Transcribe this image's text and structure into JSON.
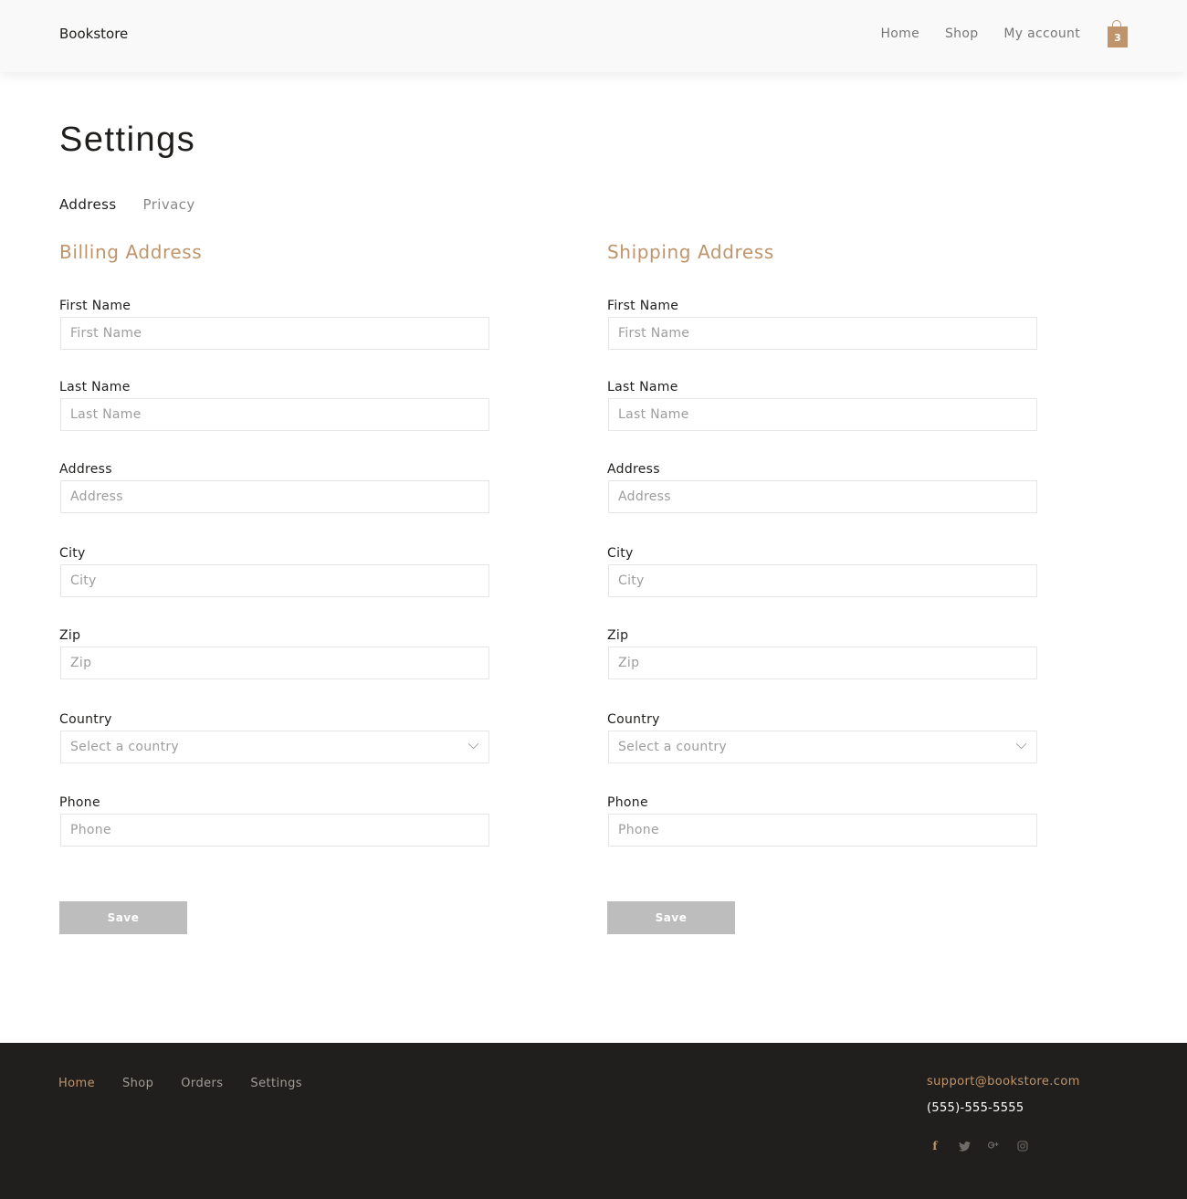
{
  "header": {
    "brand": "Bookstore",
    "nav": [
      "Home",
      "Shop",
      "My account"
    ],
    "cart_count": "3"
  },
  "page": {
    "title": "Settings",
    "tabs": [
      {
        "label": "Address",
        "active": true
      },
      {
        "label": "Privacy",
        "active": false
      }
    ]
  },
  "billing": {
    "heading": "Billing Address",
    "fields": {
      "first_name": {
        "label": "First Name",
        "placeholder": "First Name",
        "value": ""
      },
      "last_name": {
        "label": "Last Name",
        "placeholder": "Last Name",
        "value": ""
      },
      "address": {
        "label": "Address",
        "placeholder": "Address",
        "value": ""
      },
      "city": {
        "label": "City",
        "placeholder": "City",
        "value": ""
      },
      "zip": {
        "label": "Zip",
        "placeholder": "Zip",
        "value": ""
      },
      "country": {
        "label": "Country",
        "selected": "Select a country"
      },
      "phone": {
        "label": "Phone",
        "placeholder": "Phone",
        "value": ""
      }
    },
    "save_label": "Save"
  },
  "shipping": {
    "heading": "Shipping Address",
    "fields": {
      "first_name": {
        "label": "First Name",
        "placeholder": "First Name",
        "value": ""
      },
      "last_name": {
        "label": "Last Name",
        "placeholder": "Last Name",
        "value": ""
      },
      "address": {
        "label": "Address",
        "placeholder": "Address",
        "value": ""
      },
      "city": {
        "label": "City",
        "placeholder": "City",
        "value": ""
      },
      "zip": {
        "label": "Zip",
        "placeholder": "Zip",
        "value": ""
      },
      "country": {
        "label": "Country",
        "selected": "Select a country"
      },
      "phone": {
        "label": "Phone",
        "placeholder": "Phone",
        "value": ""
      }
    },
    "save_label": "Save"
  },
  "footer": {
    "nav": [
      "Home",
      "Shop",
      "Orders",
      "Settings"
    ],
    "active_nav": "Home",
    "email": "support@bookstore.com",
    "phone": "(555)-555-5555",
    "social_icons": [
      "facebook-icon",
      "twitter-icon",
      "google-plus-icon",
      "instagram-icon"
    ]
  },
  "colors": {
    "accent": "#c0946a",
    "footer_bg": "#201f1d",
    "button_bg": "#bdbdbd",
    "header_bg": "#f9f9f9"
  }
}
